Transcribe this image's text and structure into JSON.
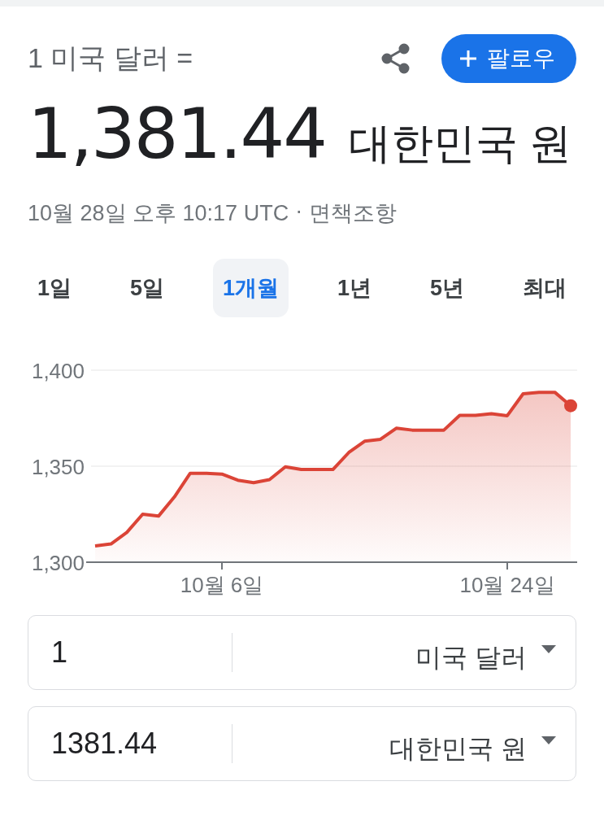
{
  "header": {
    "base_amount": "1 미국 달러 =",
    "rate": "1,381.44",
    "target_currency": "대한민국 원",
    "timestamp": "10월 28일 오후 10:17 UTC",
    "separator": "·",
    "disclaimer": "면책조항"
  },
  "follow_button": {
    "label": "팔로우"
  },
  "ranges": [
    {
      "label": "1일",
      "selected": false
    },
    {
      "label": "5일",
      "selected": false
    },
    {
      "label": "1개월",
      "selected": true
    },
    {
      "label": "1년",
      "selected": false
    },
    {
      "label": "5년",
      "selected": false
    },
    {
      "label": "최대",
      "selected": false
    }
  ],
  "chart_data": {
    "type": "area",
    "categories": [
      null,
      null,
      null,
      null,
      null,
      null,
      null,
      null,
      "10월 6일",
      null,
      null,
      null,
      null,
      null,
      null,
      null,
      null,
      null,
      null,
      null,
      null,
      null,
      null,
      null,
      null,
      null,
      "10월 24일",
      null,
      null,
      null,
      null
    ],
    "series": [
      {
        "color": "#db4437",
        "values": [
          1308.5,
          1309.5,
          1315.5,
          1325,
          1324,
          1334,
          1346.3,
          1346.3,
          1345.9,
          1342.7,
          1341.4,
          1343,
          1349.7,
          1348.3,
          1348.3,
          1348.3,
          1357.1,
          1363,
          1364,
          1369.8,
          1368.8,
          1368.8,
          1368.8,
          1376.5,
          1376.5,
          1377.3,
          1376.3,
          1387.7,
          1388.5,
          1388.5,
          1381.5
        ]
      }
    ],
    "ylim": [
      1300,
      1400
    ],
    "yticks": [
      {
        "value": 1300,
        "label": "1,300"
      },
      {
        "value": 1350,
        "label": "1,350"
      },
      {
        "value": 1400,
        "label": "1,400"
      }
    ]
  },
  "converter": [
    {
      "value": "1",
      "currency": "미국 달러"
    },
    {
      "value": "1381.44",
      "currency": "대한민국 원"
    }
  ]
}
